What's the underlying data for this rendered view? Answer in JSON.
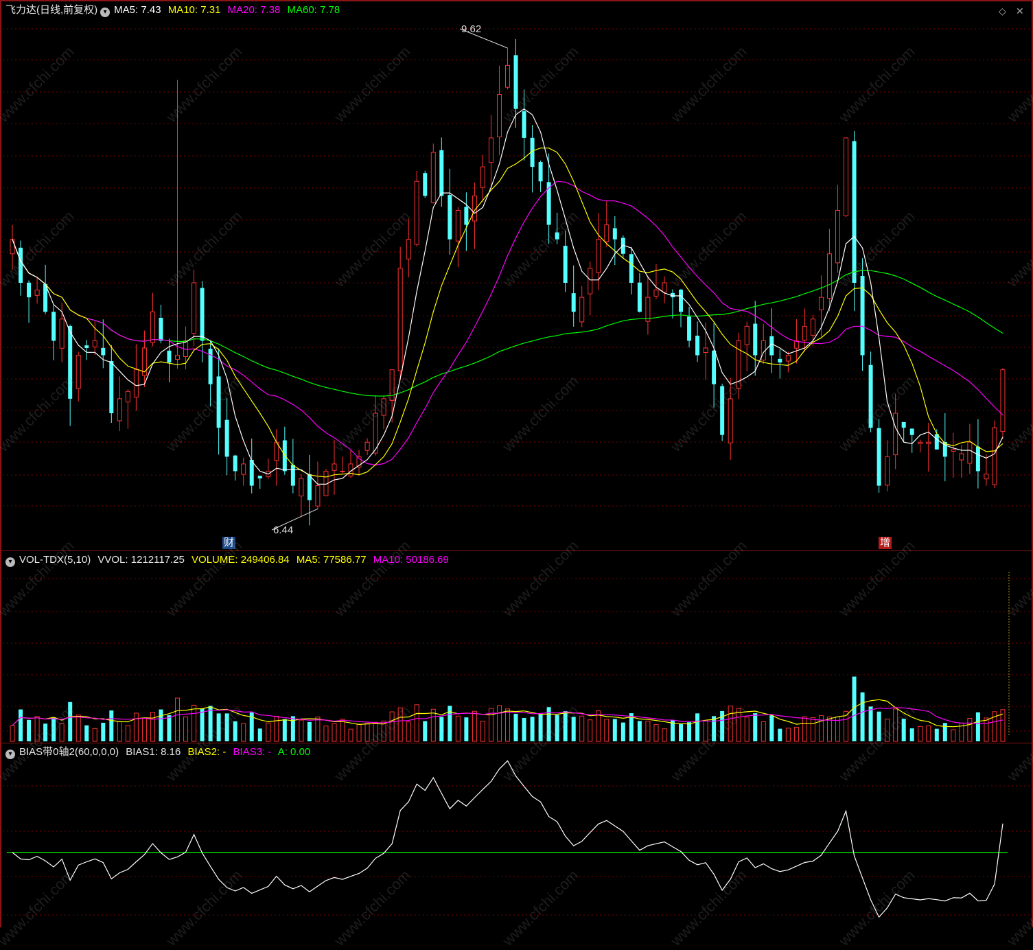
{
  "price_header": {
    "title": "飞力达(日线,前复权)",
    "ma5": "MA5: 7.43",
    "ma10": "MA10: 7.31",
    "ma20": "MA20: 7.38",
    "ma60": "MA60: 7.78"
  },
  "vol_header": {
    "title": "VOL-TDX(5,10)",
    "vvol": "VVOL: 1212117.25",
    "volume": "VOLUME: 249406.84",
    "ma5": "MA5: 77586.77",
    "ma10": "MA10: 50186.69"
  },
  "bias_header": {
    "title": "BIAS带0轴2(60,0,0,0)",
    "bias1": "BIAS1: 8.16",
    "bias2": "BIAS2: -",
    "bias3": "BIAS3: -",
    "a": "A: 0.00"
  },
  "annotations": {
    "high_label": "9.62",
    "low_label": "6.44",
    "marker_cai": "财",
    "marker_zeng": "增"
  },
  "watermark": "www.cfchi.com",
  "colors": {
    "up": "#ff3232",
    "down": "#54ffff",
    "ma5": "#ffffff",
    "ma10": "#ffff00",
    "ma20": "#ff00ff",
    "ma60": "#00ff00",
    "grid": "#7a0000",
    "border": "#8b1515"
  },
  "chart_data": {
    "type": "candlestick",
    "price_range": [
      6.2,
      9.8
    ],
    "high": 9.62,
    "low": 6.44,
    "closes": [
      8.3,
      8.0,
      7.9,
      7.95,
      7.8,
      7.6,
      7.75,
      7.2,
      7.5,
      7.55,
      7.6,
      7.5,
      7.1,
      7.2,
      7.25,
      7.4,
      7.55,
      7.8,
      7.6,
      7.45,
      7.5,
      7.6,
      8.0,
      7.6,
      7.3,
      7.0,
      6.8,
      6.7,
      6.75,
      6.6,
      6.65,
      6.7,
      6.9,
      6.7,
      6.6,
      6.65,
      6.5,
      6.6,
      6.7,
      6.75,
      6.7,
      6.75,
      6.8,
      6.9,
      7.1,
      7.2,
      7.4,
      8.1,
      8.3,
      8.7,
      8.6,
      8.9,
      8.6,
      8.3,
      8.5,
      8.4,
      8.6,
      8.8,
      9.0,
      9.3,
      9.5,
      9.2,
      9.0,
      8.8,
      8.7,
      8.4,
      8.3,
      8.0,
      7.8,
      7.9,
      8.1,
      8.3,
      8.4,
      8.3,
      8.2,
      8.0,
      7.8,
      7.9,
      7.95,
      8.0,
      7.9,
      7.8,
      7.6,
      7.5,
      7.55,
      7.3,
      6.95,
      7.2,
      7.6,
      7.7,
      7.5,
      7.6,
      7.5,
      7.45,
      7.5,
      7.6,
      7.7,
      7.75,
      7.9,
      8.2,
      8.5,
      9.0,
      8.0,
      7.5,
      7.0,
      6.6,
      6.8,
      7.1,
      7.0,
      6.95,
      6.9,
      6.9,
      6.85,
      6.8,
      6.85,
      6.82,
      6.9,
      6.7,
      6.68,
      7.0,
      7.4
    ],
    "volume_range": [
      0,
      300000
    ],
    "bias1_range": [
      -20,
      25
    ],
    "bias1_last": 8.16
  }
}
